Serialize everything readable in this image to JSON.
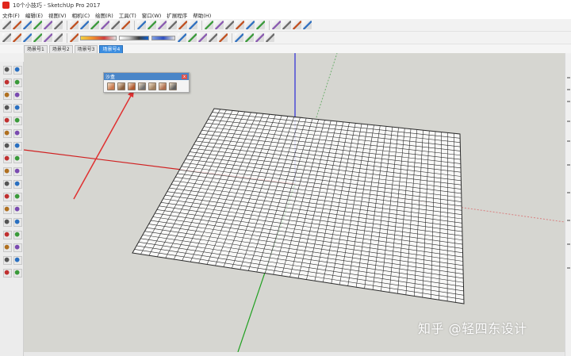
{
  "window": {
    "title": "10个小技巧 - SketchUp Pro 2017"
  },
  "menu": {
    "items": [
      "文件(F)",
      "编辑(E)",
      "视图(V)",
      "相机(C)",
      "绘图(R)",
      "工具(T)",
      "窗口(W)",
      "扩展程序",
      "帮助(H)"
    ]
  },
  "scene_tabs": [
    "场景号1",
    "场景号2",
    "场景号3",
    "场景号4"
  ],
  "active_scene_tab": "场景号4",
  "tray": {
    "title": "沙盒",
    "close_glyph": "x"
  },
  "watermark": {
    "text": "知乎 @轻四东设计"
  },
  "colors": {
    "viewport_bg": "#d6d6d1",
    "grid": "#2a2a2a",
    "axis_red": "#d02020",
    "axis_green": "#20a020",
    "axis_blue": "#2020d0",
    "annotation_arrow": "#e03030",
    "scene_tab_active": "#3b8de0"
  },
  "icons": {
    "toolbar_row1": [
      "select-arrow-icon",
      "eraser-icon",
      "line-icon",
      "arc-icon",
      "rectangle-icon",
      "circle-icon",
      "polygon-icon",
      "freehand-icon",
      "push-pull-icon",
      "move-icon",
      "rotate-icon",
      "scale-icon",
      "offset-icon",
      "follow-me-icon",
      "tape-measure-icon",
      "protractor-icon",
      "dimension-icon",
      "text-icon",
      "axes-icon",
      "3d-text-icon",
      "orbit-icon",
      "pan-icon",
      "zoom-icon",
      "zoom-extents-icon",
      "walk-icon",
      "look-around-icon",
      "section-plane-icon",
      "paint-bucket-icon"
    ],
    "toolbar_row2": [
      "components-icon",
      "materials-icon",
      "home-icon",
      "iso-view-icon",
      "top-view-icon",
      "front-view-icon",
      "right-view-icon",
      "back-view-icon",
      "left-view-icon",
      "xray-icon",
      "back-edges-icon",
      "wireframe-icon",
      "hidden-line-icon",
      "shaded-icon",
      "shaded-textures-icon",
      "monochrome-icon"
    ],
    "tray": [
      "sandbox-contours-icon",
      "sandbox-scratch-icon",
      "sandbox-smoove-icon",
      "sandbox-stamp-icon",
      "sandbox-drape-icon",
      "sandbox-add-detail-icon",
      "sandbox-flip-edge-icon"
    ],
    "left_tools": [
      "select-icon",
      "component-icon",
      "paint-icon",
      "eraser-icon",
      "line-icon",
      "freehand-icon",
      "rectangle-icon",
      "rotated-rect-icon",
      "circle-icon",
      "polygon-icon",
      "arc-icon",
      "pie-icon",
      "move-icon",
      "pushpull-icon",
      "rotate-icon",
      "followme-icon",
      "scale-icon",
      "offset-icon",
      "tape-icon",
      "dimension-icon",
      "protractor-icon",
      "text-icon",
      "axes-icon",
      "3dtext-icon",
      "orbit-icon",
      "pan-icon",
      "zoom-icon",
      "zoomwindow-icon",
      "extents-icon",
      "prev-icon",
      "walk-icon",
      "look-icon",
      "position-camera-icon",
      "section-icon"
    ]
  }
}
